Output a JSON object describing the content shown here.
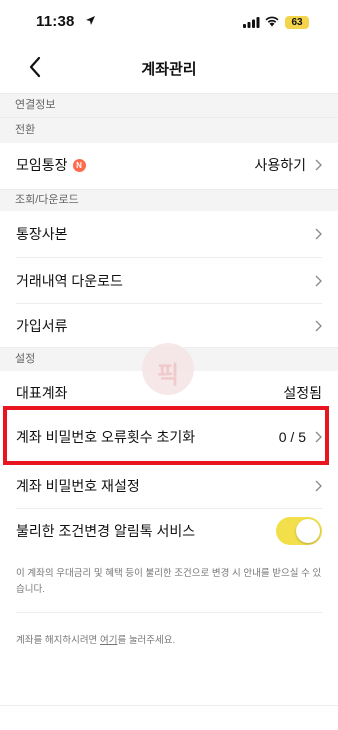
{
  "status_bar": {
    "time": "11:38",
    "battery": "63"
  },
  "nav": {
    "title": "계좌관리"
  },
  "sections": {
    "linked": "연결정보",
    "switch": "전환",
    "lookup": "조회/다운로드",
    "settings": "설정"
  },
  "rows": {
    "group_account": {
      "label": "모임통장",
      "badge": "N",
      "value": "사용하기"
    },
    "bankbook_copy": {
      "label": "통장사본"
    },
    "history_download": {
      "label": "거래내역 다운로드"
    },
    "signup_docs": {
      "label": "가입서류"
    },
    "primary_account": {
      "label": "대표계좌",
      "value": "설정됨"
    },
    "pw_error_reset": {
      "label": "계좌 비밀번호 오류횟수 초기화",
      "value": "0 / 5"
    },
    "pw_reset": {
      "label": "계좌 비밀번호 재설정"
    },
    "alert_service": {
      "label": "불리한 조건변경 알림톡 서비스",
      "enabled": true
    }
  },
  "notes": {
    "alert_desc": "이 계좌의 우대금리 및 혜택 등이 불리한 조건으로 변경 시 안내를 받으실 수 있습니다.",
    "close_prefix": "계좌를 해지하시려면 ",
    "close_link": "여기",
    "close_suffix": "를 눌러주세요."
  },
  "watermark": "픽",
  "colors": {
    "toggle": "#f3df4a",
    "highlight": "#e8141f",
    "badge": "#ff6a4b"
  }
}
